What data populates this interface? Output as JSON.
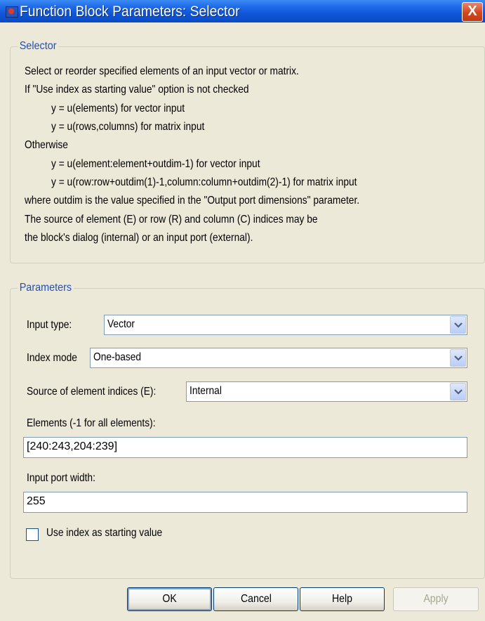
{
  "window": {
    "title": "Function Block Parameters: Selector",
    "close_glyph": "X"
  },
  "selector": {
    "legend": "Selector",
    "description": [
      "Select or reorder specified elements of an input vector or matrix.",
      "If \"Use index as starting value\" option is not checked",
      "y = u(elements) for vector input",
      "y = u(rows,columns) for matrix input",
      "Otherwise",
      "y = u(element:element+outdim-1) for vector input",
      "y = u(row:row+outdim(1)-1,column:column+outdim(2)-1) for matrix input",
      "where outdim is the value specified in the \"Output port dimensions\" parameter.",
      "The source of element (E) or row (R) and column (C) indices may be",
      "the block's dialog (internal) or an input port (external)."
    ]
  },
  "parameters": {
    "legend": "Parameters",
    "input_type": {
      "label": "Input type:",
      "value": "Vector"
    },
    "index_mode": {
      "label": "Index mode",
      "value": "One-based"
    },
    "source": {
      "label": "Source of element indices (E):",
      "value": "Internal"
    },
    "elements": {
      "label": "Elements (-1 for all elements):",
      "value": "[240:243,204:239]"
    },
    "port_width": {
      "label": "Input port width:",
      "value": "255"
    },
    "use_index": {
      "label": "Use index as starting value",
      "checked": false
    }
  },
  "buttons": {
    "ok": "OK",
    "cancel": "Cancel",
    "help": "Help",
    "apply": "Apply"
  },
  "icons": {
    "dropdown": "chevron-down-icon",
    "app": "simulink-block-icon",
    "close": "close-icon"
  }
}
